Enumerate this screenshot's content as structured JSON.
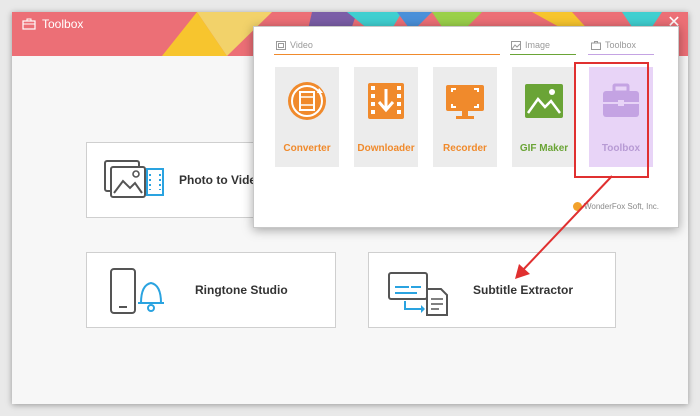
{
  "window": {
    "title": "Toolbox",
    "close_glyph": "✕"
  },
  "cards": [
    {
      "label": "Photo to Video",
      "icon": "photo-to-video-icon"
    },
    {
      "label": "Ringtone Studio",
      "icon": "ringtone-icon"
    },
    {
      "label": "Subtitle Extractor",
      "icon": "subtitle-icon"
    }
  ],
  "menu": {
    "sections": {
      "video": "Video",
      "image": "Image",
      "toolbox": "Toolbox"
    },
    "apps": [
      {
        "name": "Converter",
        "icon": "converter-icon"
      },
      {
        "name": "Downloader",
        "icon": "downloader-icon"
      },
      {
        "name": "Recorder",
        "icon": "recorder-icon"
      },
      {
        "name": "GIF Maker",
        "icon": "gif-maker-icon"
      },
      {
        "name": "Toolbox",
        "icon": "toolbox-icon",
        "selected": true
      }
    ],
    "brand": "WonderFox Soft, Inc."
  },
  "colors": {
    "title_red": "#ec6f76",
    "accent_orange": "#f08a2c",
    "gif_green": "#6aa436",
    "toolbox_purple": "#c4a3e3",
    "highlight_red": "#e03030"
  }
}
